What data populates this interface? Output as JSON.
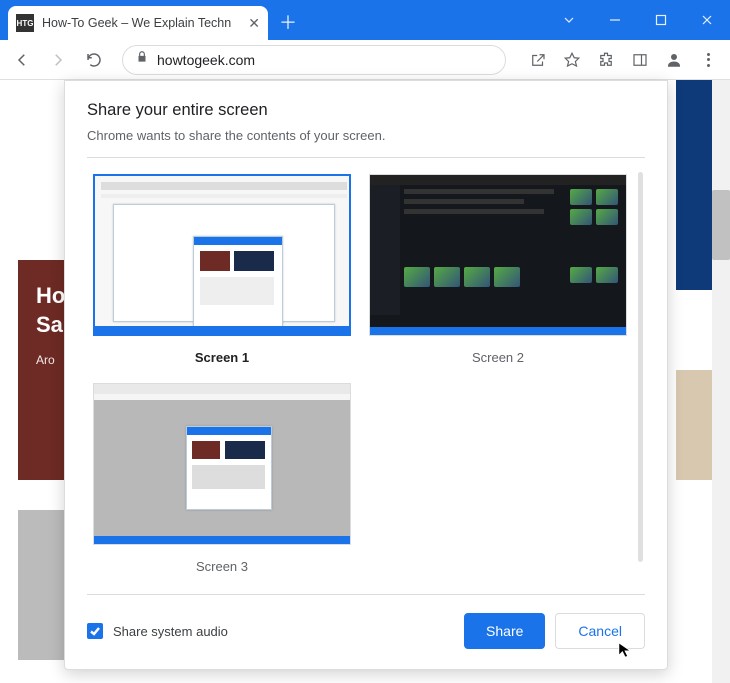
{
  "window": {
    "tab_title": "How-To Geek – We Explain Techn",
    "favicon_text": "HTG",
    "url": "howtogeek.com"
  },
  "page_bg": {
    "hero_line1": "Ho",
    "hero_line2": "Sa",
    "hero_sub": "Aro"
  },
  "dialog": {
    "title": "Share your entire screen",
    "subtitle": "Chrome wants to share the contents of your screen.",
    "screens": [
      {
        "label": "Screen 1",
        "selected": true
      },
      {
        "label": "Screen 2",
        "selected": false
      },
      {
        "label": "Screen 3",
        "selected": false
      }
    ],
    "audio_label": "Share system audio",
    "audio_checked": true,
    "share_label": "Share",
    "cancel_label": "Cancel"
  }
}
